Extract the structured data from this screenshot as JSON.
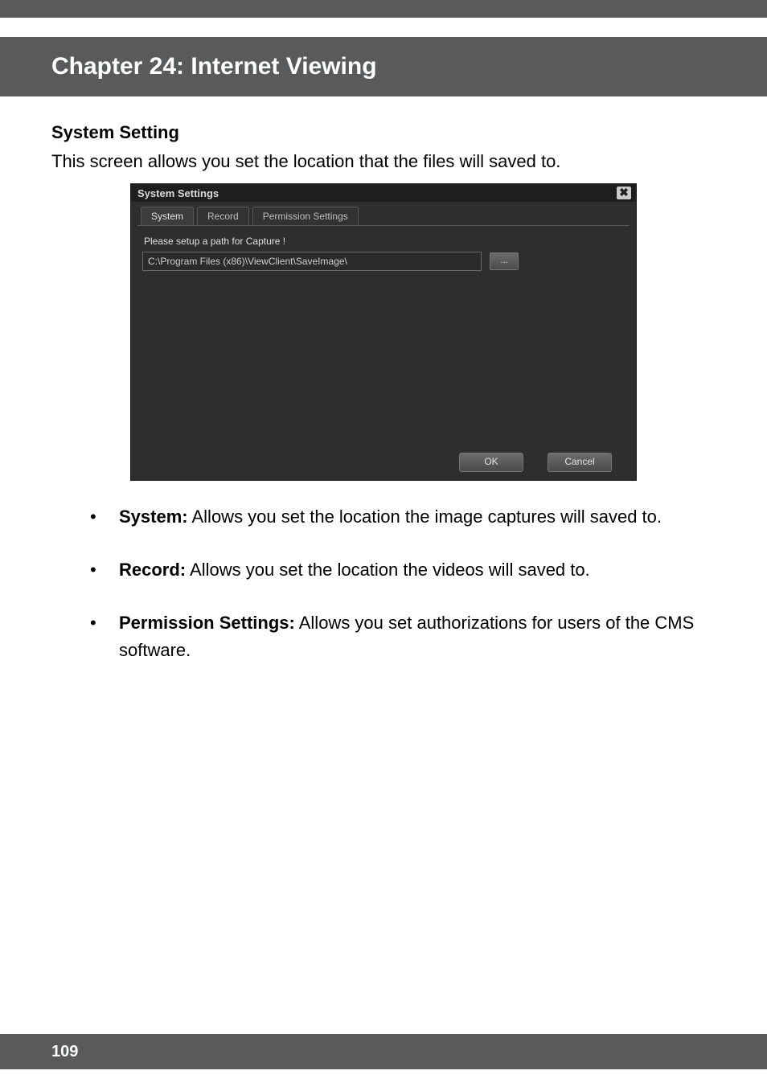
{
  "chapter_title": "Chapter 24: Internet Viewing",
  "section_heading": "System Setting",
  "intro_text": "This screen allows you set the location that the files will saved to.",
  "window": {
    "title": "System Settings",
    "close_glyph": "✖",
    "tabs": {
      "system": "System",
      "record": "Record",
      "permission": "Permission Settings"
    },
    "capture_label": "Please setup a path for Capture !",
    "capture_path": "C:\\Program Files (x86)\\ViewClient\\SaveImage\\",
    "browse_label": "...",
    "ok_label": "OK",
    "cancel_label": "Cancel"
  },
  "bullets": {
    "system_label": "System:",
    "system_text": " Allows you set the location the image captures will saved to.",
    "record_label": "Record:",
    "record_text": " Allows you set the location the videos will saved to.",
    "permission_label": "Permission Settings:",
    "permission_text": " Allows you set authorizations for users of the CMS software."
  },
  "page_number": "109"
}
